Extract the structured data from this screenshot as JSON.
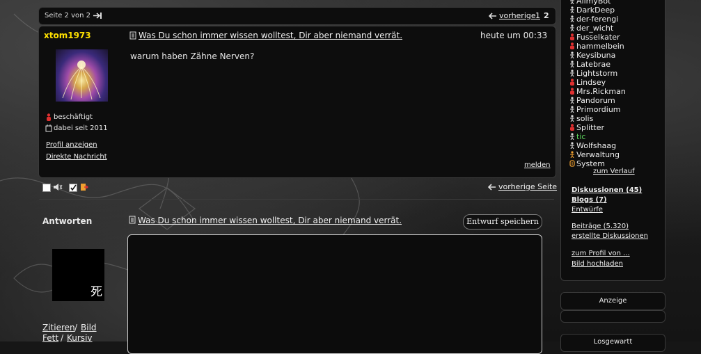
{
  "pagination": {
    "page_info": "Seite 2 von 2",
    "prev_label": "vorherige",
    "pages": [
      "1",
      "2"
    ],
    "prev_page_label": "vorherige Seite"
  },
  "post": {
    "author": "xtom1973",
    "status": "beschäftigt",
    "member_since": "dabei seit 2011",
    "profile_link": "Profil anzeigen",
    "message_link": "Direkte Nachricht",
    "title": "Was Du schon immer wissen wolltest, Dir aber niemand verrät.",
    "time": "heute um 00:33",
    "body": "warum haben Zähne Nerven?",
    "report": "melden"
  },
  "reply": {
    "heading": "Antworten",
    "title": "Was Du schon immer wissen wolltest, Dir aber niemand verrät.",
    "save_draft": "Entwurf speichern",
    "avatar_glyph": "死",
    "quote": "Zitieren",
    "image": "Bild",
    "separator": "/",
    "bold": "Fett",
    "italic": "Kursiv"
  },
  "sidebar": {
    "users": [
      {
        "name": "AlimyBot",
        "color": "#f0f0f0",
        "icon": "person-icon"
      },
      {
        "name": "DarkDeep",
        "color": "#f0f0f0",
        "icon": "person-icon"
      },
      {
        "name": "der-ferengi",
        "color": "#f0f0f0",
        "icon": "person-icon"
      },
      {
        "name": "der_wicht",
        "color": "#f0f0f0",
        "icon": "person-icon"
      },
      {
        "name": "Fusselkater",
        "color": "#f0f0f0",
        "icon": "busy-person-icon"
      },
      {
        "name": "hammelbein",
        "color": "#f0f0f0",
        "icon": "busy-person-icon"
      },
      {
        "name": "Keysibuna",
        "color": "#f0f0f0",
        "icon": "person-icon"
      },
      {
        "name": "Latebrae",
        "color": "#f0f0f0",
        "icon": "person-icon"
      },
      {
        "name": "Lightstorm",
        "color": "#f0f0f0",
        "icon": "person-icon"
      },
      {
        "name": "Lindsey",
        "color": "#f0f0f0",
        "icon": "busy-person-icon"
      },
      {
        "name": "Mrs.Rickman",
        "color": "#f0f0f0",
        "icon": "busy-person-icon"
      },
      {
        "name": "Pandorum",
        "color": "#f0f0f0",
        "icon": "person-icon"
      },
      {
        "name": "Primordium",
        "color": "#f0f0f0",
        "icon": "person-icon"
      },
      {
        "name": "solis",
        "color": "#f0f0f0",
        "icon": "person-icon"
      },
      {
        "name": "Splitter",
        "color": "#f0f0f0",
        "icon": "busy-person-icon"
      },
      {
        "name": "tic",
        "color": "#5cd65c",
        "icon": "person-icon"
      },
      {
        "name": "Wolfshaag",
        "color": "#f0f0f0",
        "icon": "person-icon"
      },
      {
        "name": "Verwaltung",
        "color": "#f0f0f0",
        "icon": "admin-person-icon"
      },
      {
        "name": "System",
        "color": "#f0f0f0",
        "icon": "system-icon"
      }
    ],
    "history_link": "zum Verlauf",
    "discussions": "Diskussionen (45)",
    "blogs": "Blogs (7)",
    "drafts": "Entwürfe",
    "posts": "Beiträge (5.320)",
    "created_discussions": "erstellte Diskussionen",
    "profile_of": "zum Profil von ...",
    "upload_image": "Bild hochladen",
    "ad_label": "Anzeige",
    "bottom_panel_label": "Losgewartt"
  },
  "colors": {
    "author": "#ffe100",
    "online_green": "#5cd65c",
    "busy_red": "#e03030",
    "panel_bg": "#0d0d0d"
  }
}
